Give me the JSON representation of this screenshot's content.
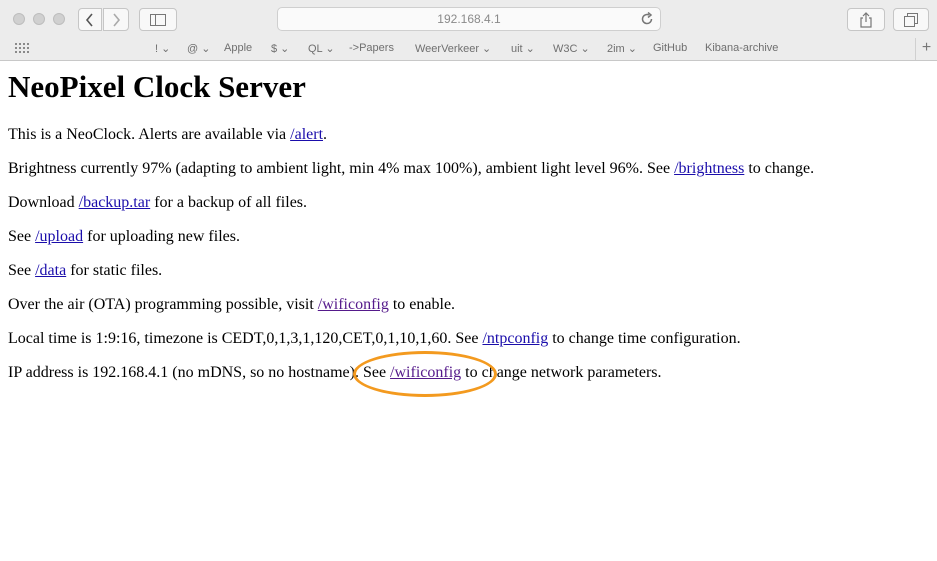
{
  "browser": {
    "url": "192.168.4.1",
    "favorites": [
      "!",
      "@",
      "Apple",
      "$",
      "QL",
      "->Papers",
      "WeerVerkeer",
      "uit",
      "W3C",
      "2im",
      "GitHub",
      "Kibana-archive"
    ],
    "add_label": "+"
  },
  "page": {
    "title": "NeoPixel Clock Server",
    "p1": {
      "pre": "This is a NeoClock. Alerts are available via ",
      "link": "/alert",
      "post": "."
    },
    "p2": {
      "pre": "Brightness currently 97% (adapting to ambient light, min 4% max 100%), ambient light level 96%. See ",
      "link": "/brightness",
      "post": " to change."
    },
    "p3": {
      "pre": "Download ",
      "link": "/backup.tar",
      "post": " for a backup of all files."
    },
    "p4": {
      "pre": "See ",
      "link": "/upload",
      "post": " for uploading new files."
    },
    "p5": {
      "pre": "See ",
      "link": "/data",
      "post": " for static files."
    },
    "p6": {
      "pre": "Over the air (OTA) programming possible, visit ",
      "link": "/wificonfig",
      "post": " to enable."
    },
    "p7": {
      "pre": "Local time is 1:9:16, timezone is CEDT,0,1,3,1,120,CET,0,1,10,1,60. See ",
      "link": "/ntpconfig",
      "post": " to change time configuration."
    },
    "p8": {
      "pre": "IP address is 192.168.4.1 (no mDNS, so no hostname). See ",
      "link": "/wificonfig",
      "post": " to change network parameters."
    }
  },
  "colors": {
    "highlight_circle": "#f39a1f",
    "link": "#1a0dab",
    "visited_link": "#551a8b"
  }
}
